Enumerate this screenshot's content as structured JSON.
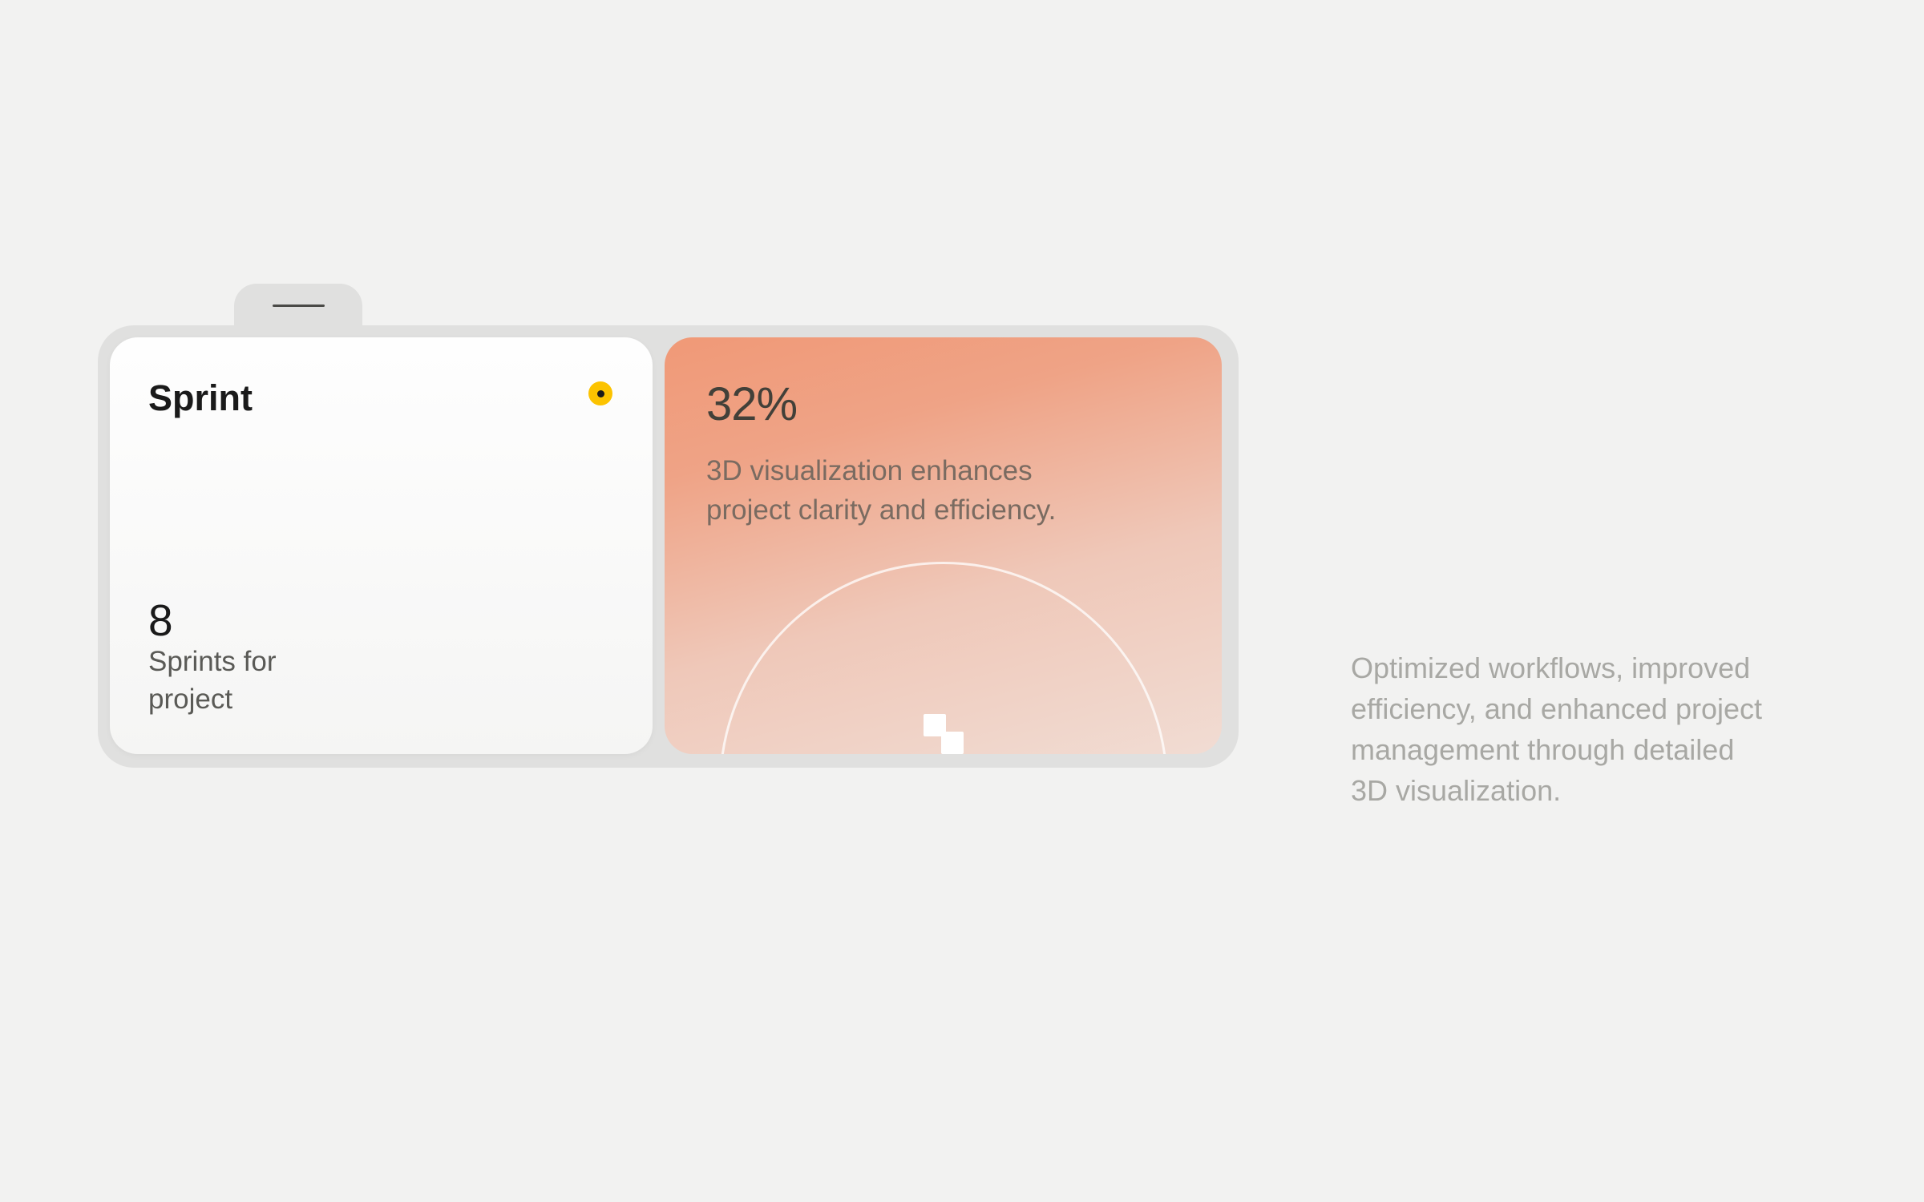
{
  "sprint_card": {
    "title": "Sprint",
    "count": "8",
    "label": "Sprints for project"
  },
  "viz_card": {
    "percent": "32%",
    "description": "3D visualization enhances project clarity and efficiency."
  },
  "side_text": "Optimized workflows, improved efficiency, and enhanced project management through detailed 3D visualization."
}
